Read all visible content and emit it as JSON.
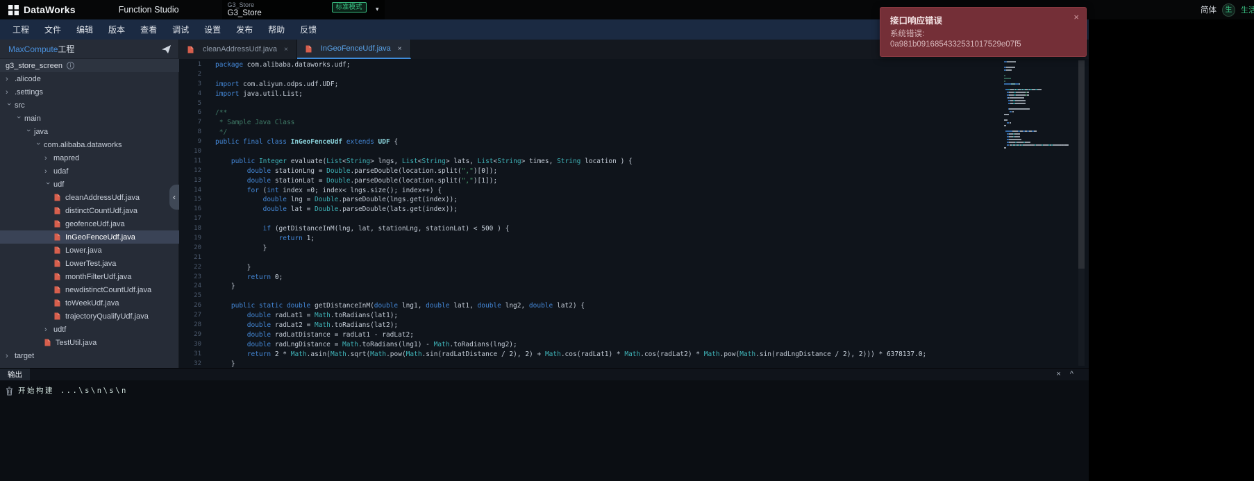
{
  "colors": {
    "accent_blue": "#3f8cdb",
    "badge_green": "#3ac183",
    "toast_red": "#742f37"
  },
  "topbar": {
    "logo": "DataWorks",
    "app": "Function Studio",
    "project_small": "G3_Store",
    "project": "G3_Store",
    "mode_badge": "标准模式",
    "lang": "简体",
    "account": "生活区"
  },
  "menubar": {
    "items": [
      "工程",
      "文件",
      "编辑",
      "版本",
      "查看",
      "调试",
      "设置",
      "发布",
      "帮助",
      "反馈"
    ]
  },
  "toast": {
    "title": "接口响应错误",
    "body_label": "系统错误:",
    "body_value": "0a981b0916854332531017529e07f5"
  },
  "sidebar": {
    "title_en": "MaxCompute",
    "title_cn": "工程",
    "tree": [
      {
        "label": "g3_store_screen",
        "indent": 0,
        "kind": "root"
      },
      {
        "label": ".alicode",
        "indent": 0,
        "kind": "dir",
        "open": false
      },
      {
        "label": ".settings",
        "indent": 0,
        "kind": "dir",
        "open": false
      },
      {
        "label": "src",
        "indent": 0,
        "kind": "dir",
        "open": true
      },
      {
        "label": "main",
        "indent": 1,
        "kind": "dir",
        "open": true
      },
      {
        "label": "java",
        "indent": 2,
        "kind": "dir",
        "open": true
      },
      {
        "label": "com.alibaba.dataworks",
        "indent": 3,
        "kind": "dir",
        "open": true
      },
      {
        "label": "mapred",
        "indent": 4,
        "kind": "dir",
        "open": false
      },
      {
        "label": "udaf",
        "indent": 4,
        "kind": "dir",
        "open": false
      },
      {
        "label": "udf",
        "indent": 4,
        "kind": "dir",
        "open": true
      },
      {
        "label": "cleanAddressUdf.java",
        "indent": 5,
        "kind": "file"
      },
      {
        "label": "distinctCountUdf.java",
        "indent": 5,
        "kind": "file"
      },
      {
        "label": "geofenceUdf.java",
        "indent": 5,
        "kind": "file"
      },
      {
        "label": "InGeoFenceUdf.java",
        "indent": 5,
        "kind": "file",
        "selected": true
      },
      {
        "label": "Lower.java",
        "indent": 5,
        "kind": "file"
      },
      {
        "label": "LowerTest.java",
        "indent": 5,
        "kind": "file"
      },
      {
        "label": "monthFilterUdf.java",
        "indent": 5,
        "kind": "file"
      },
      {
        "label": "newdistinctCountUdf.java",
        "indent": 5,
        "kind": "file"
      },
      {
        "label": "toWeekUdf.java",
        "indent": 5,
        "kind": "file"
      },
      {
        "label": "trajectoryQualifyUdf.java",
        "indent": 5,
        "kind": "file"
      },
      {
        "label": "udtf",
        "indent": 4,
        "kind": "dir",
        "open": false
      },
      {
        "label": "TestUtil.java",
        "indent": 4,
        "kind": "file"
      },
      {
        "label": "target",
        "indent": 0,
        "kind": "dir",
        "open": false
      }
    ]
  },
  "tabs": [
    {
      "label": "cleanAddressUdf.java",
      "active": false
    },
    {
      "label": "InGeoFenceUdf.java",
      "active": true
    }
  ],
  "editor": {
    "lines": [
      [
        [
          "k",
          "package"
        ],
        [
          "p",
          " com.alibaba.dataworks.udf;"
        ]
      ],
      [],
      [
        [
          "k",
          "import"
        ],
        [
          "p",
          " com.aliyun.odps.udf.UDF;"
        ]
      ],
      [
        [
          "k",
          "import"
        ],
        [
          "p",
          " java.util.List;"
        ]
      ],
      [],
      [
        [
          "c",
          "/**"
        ]
      ],
      [
        [
          "c",
          " * Sample Java Class"
        ]
      ],
      [
        [
          "c",
          " */"
        ]
      ],
      [
        [
          "k",
          "public final class "
        ],
        [
          "d",
          "InGeoFenceUdf"
        ],
        [
          "k",
          " extends "
        ],
        [
          "d",
          "UDF"
        ],
        [
          "p",
          " {"
        ]
      ],
      [],
      [
        [
          "p",
          "    "
        ],
        [
          "k",
          "public "
        ],
        [
          "t",
          "Integer"
        ],
        [
          "p",
          " evaluate("
        ],
        [
          "t",
          "List"
        ],
        [
          "p",
          "<"
        ],
        [
          "t",
          "String"
        ],
        [
          "p",
          "> lngs, "
        ],
        [
          "t",
          "List"
        ],
        [
          "p",
          "<"
        ],
        [
          "t",
          "String"
        ],
        [
          "p",
          "> lats, "
        ],
        [
          "t",
          "List"
        ],
        [
          "p",
          "<"
        ],
        [
          "t",
          "String"
        ],
        [
          "p",
          "> times, "
        ],
        [
          "t",
          "String"
        ],
        [
          "p",
          " location ) {"
        ]
      ],
      [
        [
          "p",
          "        "
        ],
        [
          "k",
          "double"
        ],
        [
          "p",
          " stationLng = "
        ],
        [
          "t",
          "Double"
        ],
        [
          "p",
          ".parseDouble(location.split("
        ],
        [
          "s",
          "\",\""
        ],
        [
          "p",
          ")["
        ],
        [
          "n",
          "0"
        ],
        [
          "p",
          "]);"
        ]
      ],
      [
        [
          "p",
          "        "
        ],
        [
          "k",
          "double"
        ],
        [
          "p",
          " stationLat = "
        ],
        [
          "t",
          "Double"
        ],
        [
          "p",
          ".parseDouble(location.split("
        ],
        [
          "s",
          "\",\""
        ],
        [
          "p",
          ")["
        ],
        [
          "n",
          "1"
        ],
        [
          "p",
          "]);"
        ]
      ],
      [
        [
          "p",
          "        "
        ],
        [
          "k",
          "for"
        ],
        [
          "p",
          " ("
        ],
        [
          "k",
          "int"
        ],
        [
          "p",
          " index ="
        ],
        [
          "n",
          "0"
        ],
        [
          "p",
          "; index< lngs.size(); index++) {"
        ]
      ],
      [
        [
          "p",
          "            "
        ],
        [
          "k",
          "double"
        ],
        [
          "p",
          " lng = "
        ],
        [
          "t",
          "Double"
        ],
        [
          "p",
          ".parseDouble(lngs.get(index));"
        ]
      ],
      [
        [
          "p",
          "            "
        ],
        [
          "k",
          "double"
        ],
        [
          "p",
          " lat = "
        ],
        [
          "t",
          "Double"
        ],
        [
          "p",
          ".parseDouble(lats.get(index));"
        ]
      ],
      [],
      [
        [
          "p",
          "            "
        ],
        [
          "k",
          "if"
        ],
        [
          "p",
          " (getDistanceInM(lng, lat, stationLng, stationLat) < "
        ],
        [
          "n",
          "500"
        ],
        [
          "p",
          " ) {"
        ]
      ],
      [
        [
          "p",
          "                "
        ],
        [
          "k",
          "return"
        ],
        [
          "p",
          " "
        ],
        [
          "n",
          "1"
        ],
        [
          "p",
          ";"
        ]
      ],
      [
        [
          "p",
          "            }"
        ]
      ],
      [],
      [
        [
          "p",
          "        }"
        ]
      ],
      [
        [
          "p",
          "        "
        ],
        [
          "k",
          "return"
        ],
        [
          "p",
          " "
        ],
        [
          "n",
          "0"
        ],
        [
          "p",
          ";"
        ]
      ],
      [
        [
          "p",
          "    }"
        ]
      ],
      [],
      [
        [
          "p",
          "    "
        ],
        [
          "k",
          "public static double"
        ],
        [
          "p",
          " getDistanceInM("
        ],
        [
          "k",
          "double"
        ],
        [
          "p",
          " lng1, "
        ],
        [
          "k",
          "double"
        ],
        [
          "p",
          " lat1, "
        ],
        [
          "k",
          "double"
        ],
        [
          "p",
          " lng2, "
        ],
        [
          "k",
          "double"
        ],
        [
          "p",
          " lat2) {"
        ]
      ],
      [
        [
          "p",
          "        "
        ],
        [
          "k",
          "double"
        ],
        [
          "p",
          " radLat1 = "
        ],
        [
          "t",
          "Math"
        ],
        [
          "p",
          ".toRadians(lat1);"
        ]
      ],
      [
        [
          "p",
          "        "
        ],
        [
          "k",
          "double"
        ],
        [
          "p",
          " radLat2 = "
        ],
        [
          "t",
          "Math"
        ],
        [
          "p",
          ".toRadians(lat2);"
        ]
      ],
      [
        [
          "p",
          "        "
        ],
        [
          "k",
          "double"
        ],
        [
          "p",
          " radLatDistance = radLat1 - radLat2;"
        ]
      ],
      [
        [
          "p",
          "        "
        ],
        [
          "k",
          "double"
        ],
        [
          "p",
          " radLngDistance = "
        ],
        [
          "t",
          "Math"
        ],
        [
          "p",
          ".toRadians(lng1) - "
        ],
        [
          "t",
          "Math"
        ],
        [
          "p",
          ".toRadians(lng2);"
        ]
      ],
      [
        [
          "p",
          "        "
        ],
        [
          "k",
          "return"
        ],
        [
          "p",
          " "
        ],
        [
          "n",
          "2"
        ],
        [
          "p",
          " * "
        ],
        [
          "t",
          "Math"
        ],
        [
          "p",
          ".asin("
        ],
        [
          "t",
          "Math"
        ],
        [
          "p",
          ".sqrt("
        ],
        [
          "t",
          "Math"
        ],
        [
          "p",
          ".pow("
        ],
        [
          "t",
          "Math"
        ],
        [
          "p",
          ".sin(radLatDistance / "
        ],
        [
          "n",
          "2"
        ],
        [
          "p",
          "), "
        ],
        [
          "n",
          "2"
        ],
        [
          "p",
          ") + "
        ],
        [
          "t",
          "Math"
        ],
        [
          "p",
          ".cos(radLat1) * "
        ],
        [
          "t",
          "Math"
        ],
        [
          "p",
          ".cos(radLat2) * "
        ],
        [
          "t",
          "Math"
        ],
        [
          "p",
          ".pow("
        ],
        [
          "t",
          "Math"
        ],
        [
          "p",
          ".sin(radLngDistance / "
        ],
        [
          "n",
          "2"
        ],
        [
          "p",
          "), "
        ],
        [
          "n",
          "2"
        ],
        [
          "p",
          "))) * "
        ],
        [
          "n",
          "6378137.0"
        ],
        [
          "p",
          ";"
        ]
      ],
      [
        [
          "p",
          "    }"
        ]
      ]
    ]
  },
  "output": {
    "tab": "输出",
    "text": "开始构建 ...\\s\\n\\s\\n"
  }
}
